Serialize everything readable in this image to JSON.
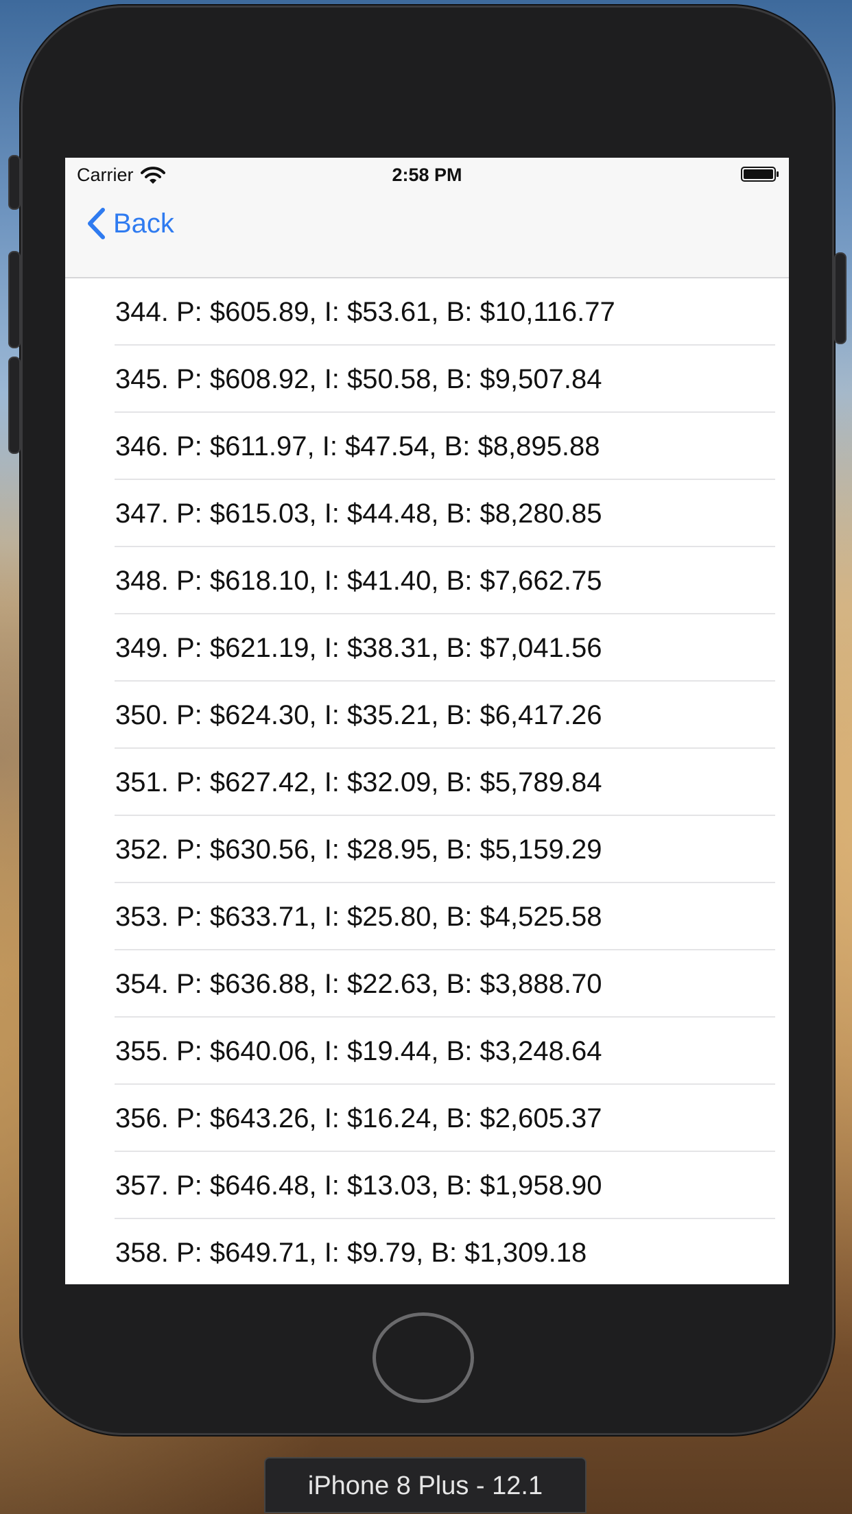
{
  "status_bar": {
    "carrier": "Carrier",
    "time": "2:58 PM"
  },
  "nav": {
    "back_label": "Back",
    "tint_color": "#2f7bf0"
  },
  "rows": [
    "344. P: $605.89, I: $53.61, B: $10,116.77",
    "345. P: $608.92, I: $50.58, B: $9,507.84",
    "346. P: $611.97, I: $47.54, B: $8,895.88",
    "347. P: $615.03, I: $44.48, B: $8,280.85",
    "348. P: $618.10, I: $41.40, B: $7,662.75",
    "349. P: $621.19, I: $38.31, B: $7,041.56",
    "350. P: $624.30, I: $35.21, B: $6,417.26",
    "351. P: $627.42, I: $32.09, B: $5,789.84",
    "352. P: $630.56, I: $28.95, B: $5,159.29",
    "353. P: $633.71, I: $25.80, B: $4,525.58",
    "354. P: $636.88, I: $22.63, B: $3,888.70",
    "355. P: $640.06, I: $19.44, B: $3,248.64",
    "356. P: $643.26, I: $16.24, B: $2,605.37",
    "357. P: $646.48, I: $13.03, B: $1,958.90",
    "358. P: $649.71, I: $9.79, B: $1,309.18"
  ],
  "simulator": {
    "device_label": "iPhone 8 Plus - 12.1"
  }
}
